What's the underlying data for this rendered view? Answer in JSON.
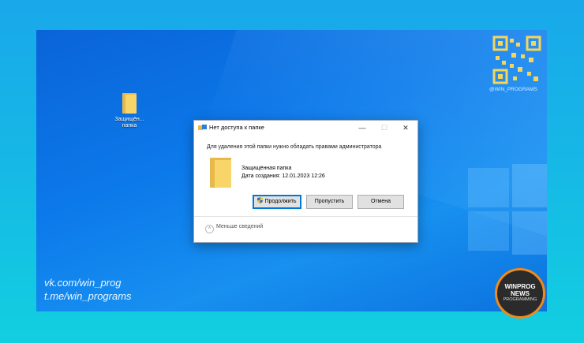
{
  "desktop": {
    "folder_label": "Защищён...\nпапка"
  },
  "dialog": {
    "title": "Нет доступа к папке",
    "message": "Для удаления этой папки нужно обладать правами администратора",
    "file_name": "Защищённая папка",
    "file_date": "Дата создания: 12.01.2023 12:26",
    "buttons": {
      "continue": "Продолжить",
      "skip": "Пропустить",
      "cancel": "Отмена"
    },
    "less_details": "Меньше сведений",
    "titlebar": {
      "minimize": "—",
      "maximize": "☐",
      "close": "✕"
    }
  },
  "overlay": {
    "handle": "@WIN_PROGRAMS",
    "links": [
      "vk.com/win_prog",
      "t.me/win_programs"
    ],
    "badge": {
      "line1": "WINPROG",
      "line2": "NEWS",
      "line3": "PROGRAMMING"
    }
  },
  "colors": {
    "accent": "#0078d7",
    "folder_front": "#f8d568",
    "folder_back": "#e8b84a",
    "badge_ring": "#f08a1c"
  }
}
